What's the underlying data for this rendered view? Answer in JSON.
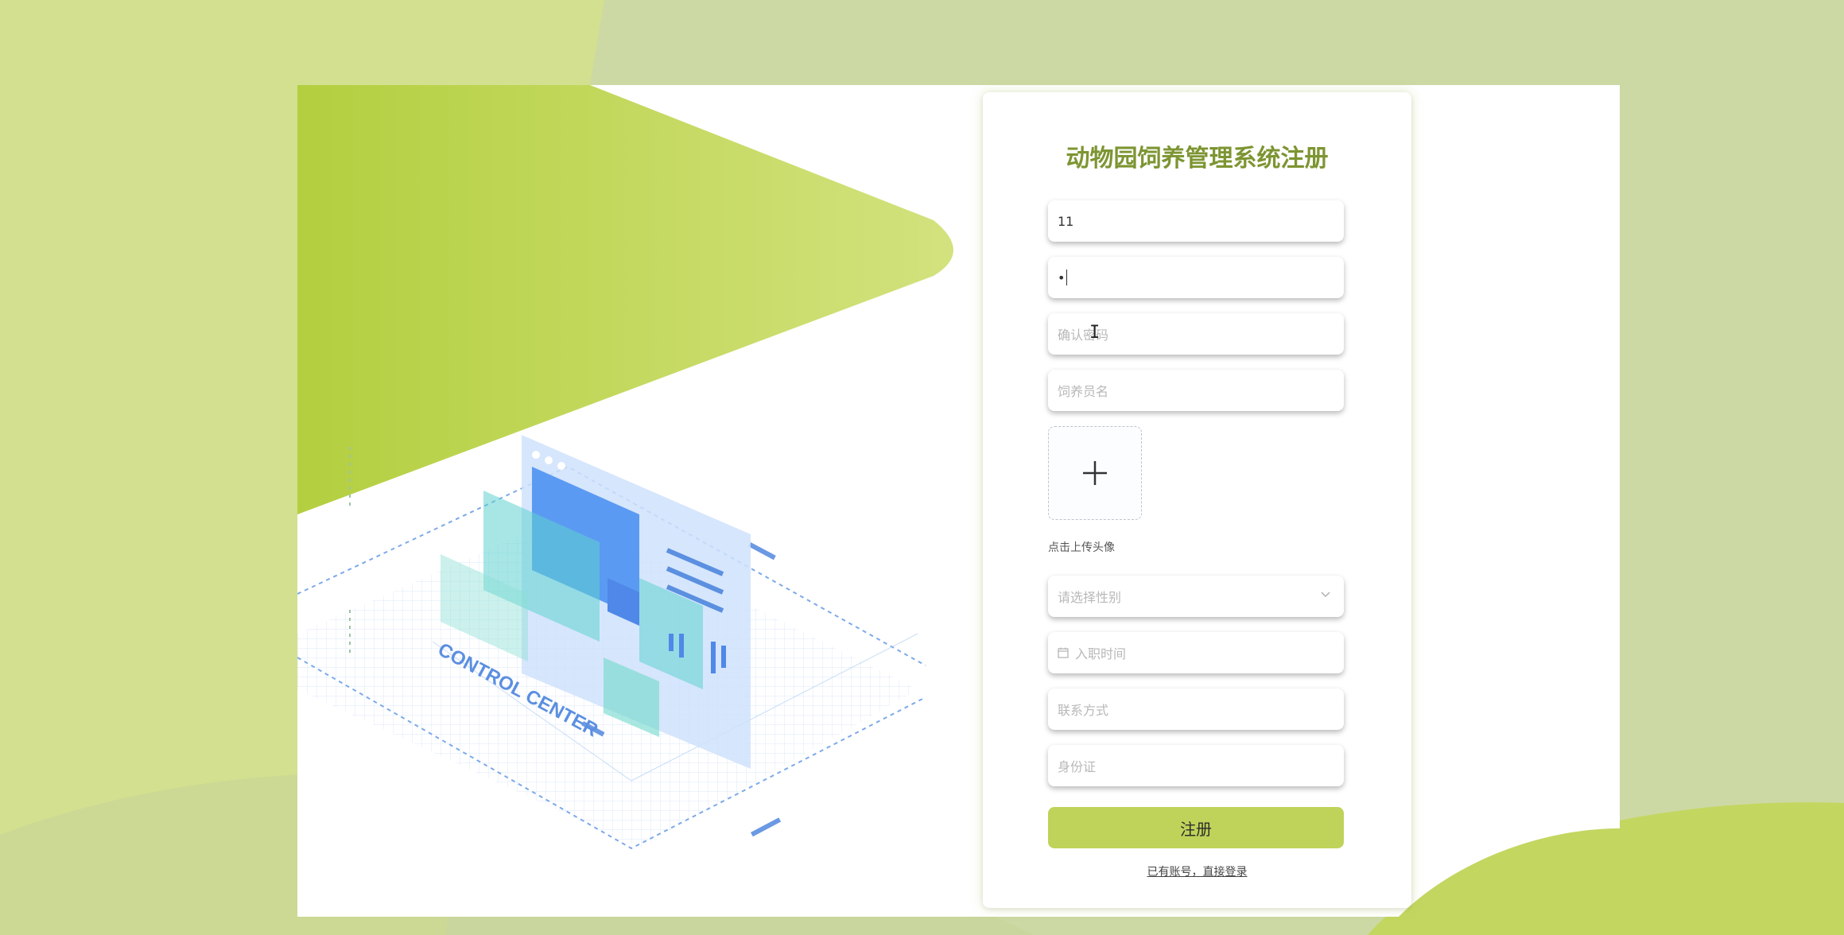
{
  "form": {
    "title": "动物园饲养管理系统注册",
    "username": {
      "value": "11"
    },
    "password": {
      "value": "•"
    },
    "confirm_password": {
      "placeholder": "确认密码"
    },
    "keeper_name": {
      "placeholder": "饲养员名"
    },
    "avatar_upload": {
      "label": "点击上传头像",
      "icon": "plus-icon"
    },
    "gender_select": {
      "placeholder": "请选择性别",
      "icon": "chevron-down-icon"
    },
    "hire_date": {
      "placeholder": "入职时间",
      "icon": "calendar-icon"
    },
    "contact": {
      "placeholder": "联系方式"
    },
    "id_card": {
      "placeholder": "身份证"
    },
    "submit_label": "注册",
    "login_link": "已有账号，直接登录"
  },
  "illustration": {
    "caption": "CONTROL CENTER"
  },
  "colors": {
    "accent": "#bfd35a",
    "title": "#7d9532",
    "page_bg": "#cdd9a4"
  }
}
